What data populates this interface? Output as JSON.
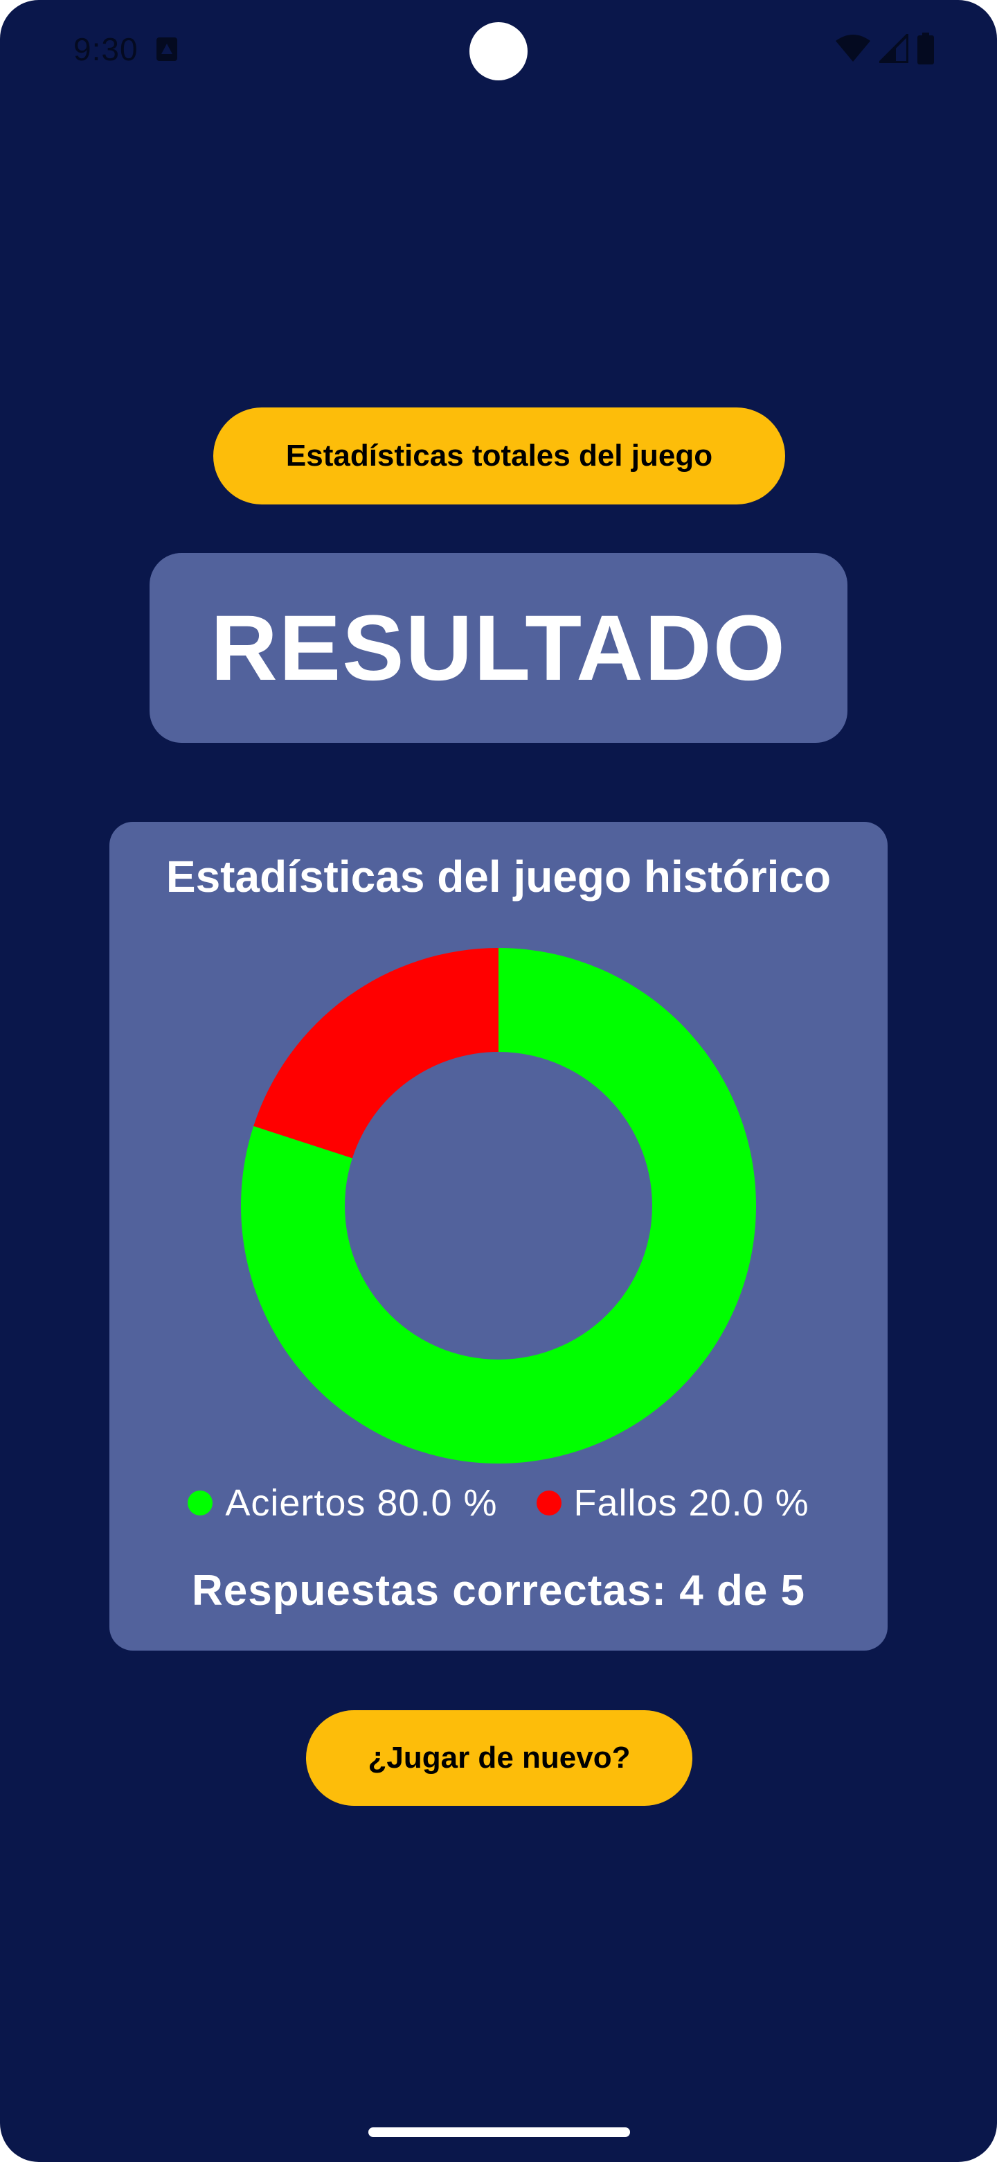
{
  "status_bar": {
    "time": "9:30",
    "icons": [
      "app-notification-icon",
      "wifi-icon",
      "cell-signal-icon",
      "battery-icon"
    ]
  },
  "buttons": {
    "stats_total_label": "Estadísticas totales del juego",
    "play_again_label": "¿Jugar de nuevo?"
  },
  "result": {
    "title": "RESULTADO"
  },
  "stats": {
    "heading": "Estadísticas del juego histórico",
    "correct_answers_text": "Respuestas correctas: 4 de 5"
  },
  "colors": {
    "background": "#0a174b",
    "card": "#52629c",
    "accent": "#fdbd0a",
    "hits": "#00ff00",
    "misses": "#ff0000"
  },
  "chart_data": {
    "type": "pie",
    "style": "donut",
    "categories": [
      "Aciertos",
      "Fallos"
    ],
    "values": [
      80.0,
      20.0
    ],
    "colors": [
      "#00ff00",
      "#ff0000"
    ],
    "legend": [
      "Aciertos 80.0 %",
      "Fallos 20.0 %"
    ],
    "legend_position": "bottom"
  }
}
